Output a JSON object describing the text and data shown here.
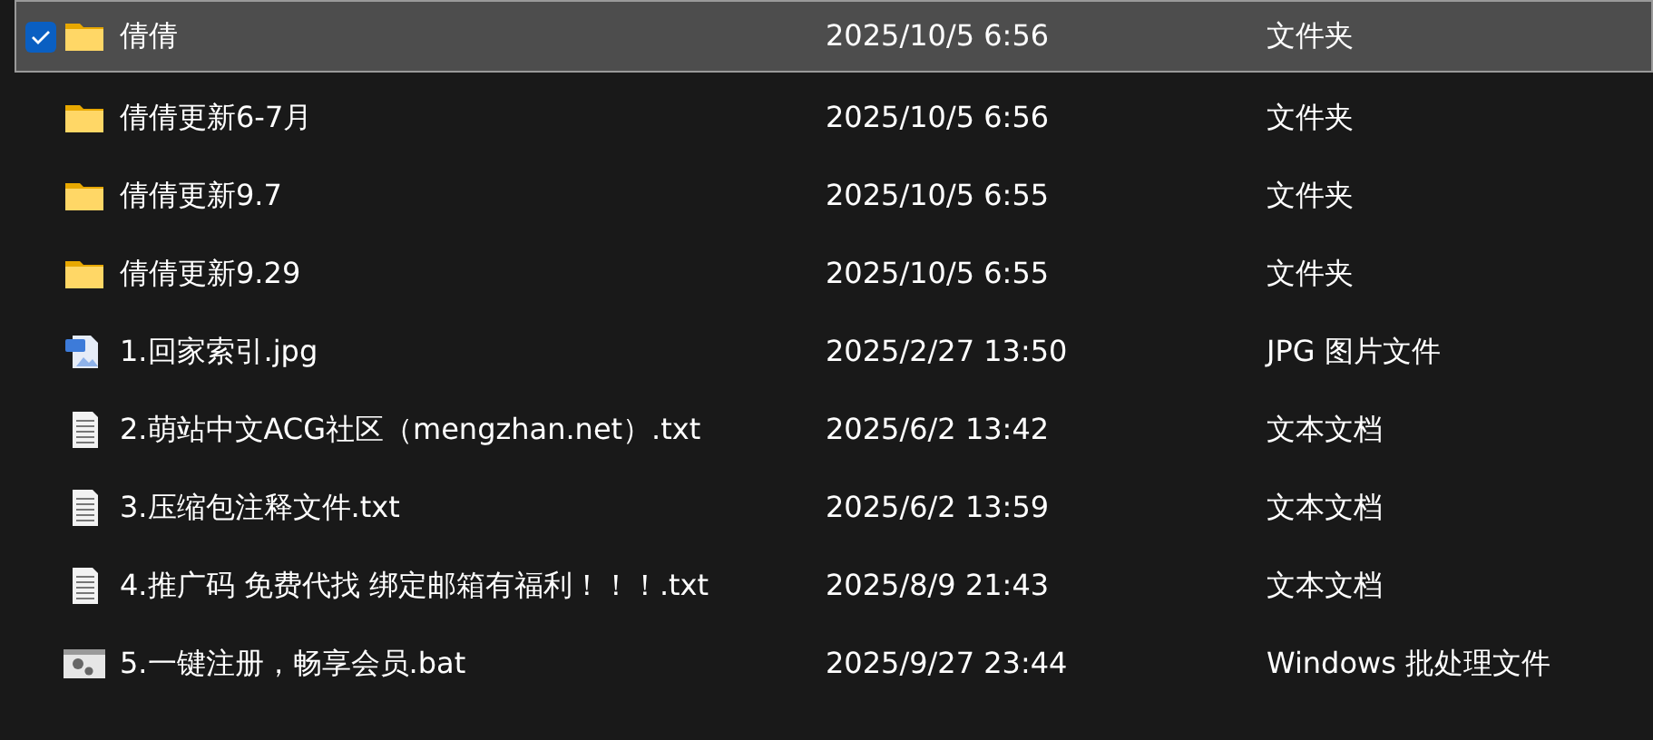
{
  "files": [
    {
      "name": "倩倩",
      "modified": "2025/10/5 6:56",
      "type": "文件夹",
      "kind": "folder",
      "selected": true
    },
    {
      "name": "倩倩更新6-7月",
      "modified": "2025/10/5 6:56",
      "type": "文件夹",
      "kind": "folder",
      "selected": false
    },
    {
      "name": "倩倩更新9.7",
      "modified": "2025/10/5 6:55",
      "type": "文件夹",
      "kind": "folder",
      "selected": false
    },
    {
      "name": "倩倩更新9.29",
      "modified": "2025/10/5 6:55",
      "type": "文件夹",
      "kind": "folder",
      "selected": false
    },
    {
      "name": "1.回家索引.jpg",
      "modified": "2025/2/27 13:50",
      "type": "JPG 图片文件",
      "kind": "image",
      "selected": false
    },
    {
      "name": "2.萌站中文ACG社区（mengzhan.net）.txt",
      "modified": "2025/6/2 13:42",
      "type": "文本文档",
      "kind": "text",
      "selected": false
    },
    {
      "name": "3.压缩包注释文件.txt",
      "modified": "2025/6/2 13:59",
      "type": "文本文档",
      "kind": "text",
      "selected": false
    },
    {
      "name": "4.推广码 免费代找 绑定邮箱有福利！！！.txt",
      "modified": "2025/8/9 21:43",
      "type": "文本文档",
      "kind": "text",
      "selected": false
    },
    {
      "name": "5.一键注册，畅享会员.bat",
      "modified": "2025/9/27 23:44",
      "type": "Windows 批处理文件",
      "kind": "batch",
      "selected": false
    }
  ]
}
